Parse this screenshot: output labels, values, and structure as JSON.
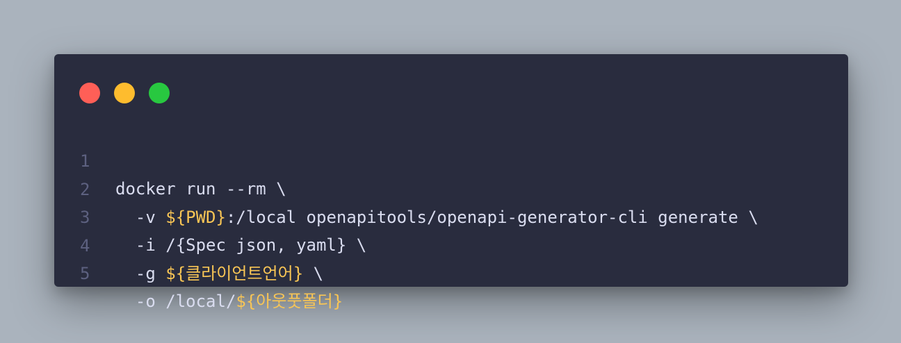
{
  "colors": {
    "background": "#aab3bd",
    "window": "#292c3e",
    "close": "#ff5f57",
    "minimize": "#febc2e",
    "maximize": "#28c840",
    "text": "#d9dcef",
    "variable": "#f8c555",
    "line_number": "#5d6180"
  },
  "window_controls": [
    "close",
    "minimize",
    "maximize"
  ],
  "code": {
    "lines": [
      {
        "n": "1",
        "parts": [
          {
            "t": "docker run --rm \\",
            "k": "plain"
          }
        ]
      },
      {
        "n": "2",
        "parts": [
          {
            "t": "  -v ",
            "k": "plain"
          },
          {
            "t": "${PWD}",
            "k": "var"
          },
          {
            "t": ":/local openapitools/openapi-generator-cli generate \\",
            "k": "plain"
          }
        ]
      },
      {
        "n": "3",
        "parts": [
          {
            "t": "  -i /{Spec json, yaml} \\",
            "k": "plain"
          }
        ]
      },
      {
        "n": "4",
        "parts": [
          {
            "t": "  -g ",
            "k": "plain"
          },
          {
            "t": "${클라이언트언어}",
            "k": "var"
          },
          {
            "t": " \\",
            "k": "plain"
          }
        ]
      },
      {
        "n": "5",
        "parts": [
          {
            "t": "  -o /local/",
            "k": "plain"
          },
          {
            "t": "${아웃풋폴더}",
            "k": "var"
          }
        ]
      }
    ]
  }
}
